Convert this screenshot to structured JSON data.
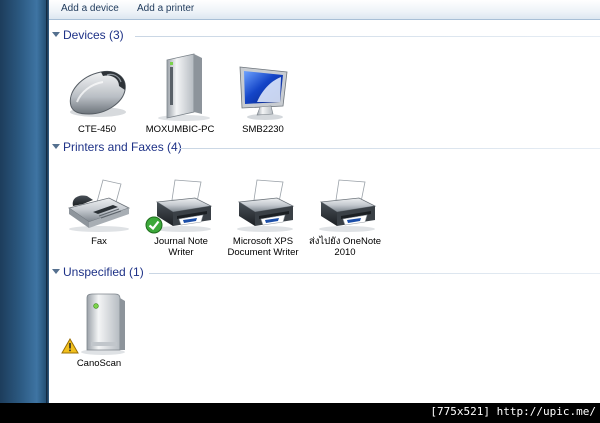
{
  "toolbar": {
    "add_device": "Add a device",
    "add_printer": "Add a printer"
  },
  "groups": {
    "devices": {
      "title": "Devices (3)",
      "items": [
        {
          "label": "CTE-450",
          "icon": "mouse-icon"
        },
        {
          "label": "MOXUMBIC-PC",
          "icon": "computer-tower-icon"
        },
        {
          "label": "SMB2230",
          "icon": "monitor-icon"
        }
      ]
    },
    "printers": {
      "title": "Printers and Faxes (4)",
      "items": [
        {
          "label": "Fax",
          "icon": "fax-icon"
        },
        {
          "label": "Journal Note\nWriter",
          "icon": "printer-icon",
          "default": true
        },
        {
          "label": "Microsoft XPS\nDocument Writer",
          "icon": "printer-icon"
        },
        {
          "label": "ส่งไปยัง OneNote\n2010",
          "icon": "printer-icon"
        }
      ]
    },
    "unspecified": {
      "title": "Unspecified (1)",
      "items": [
        {
          "label": "CanoScan",
          "icon": "scanner-icon",
          "warning": true
        }
      ]
    }
  },
  "watermark": "[775x521] http://upic.me/",
  "colors": {
    "group_title": "#1e3287",
    "toolbar_text": "#1e395b",
    "accent_blue": "#1b4ea8",
    "default_check": "#3ca83a",
    "warning": "#f2c01c"
  }
}
